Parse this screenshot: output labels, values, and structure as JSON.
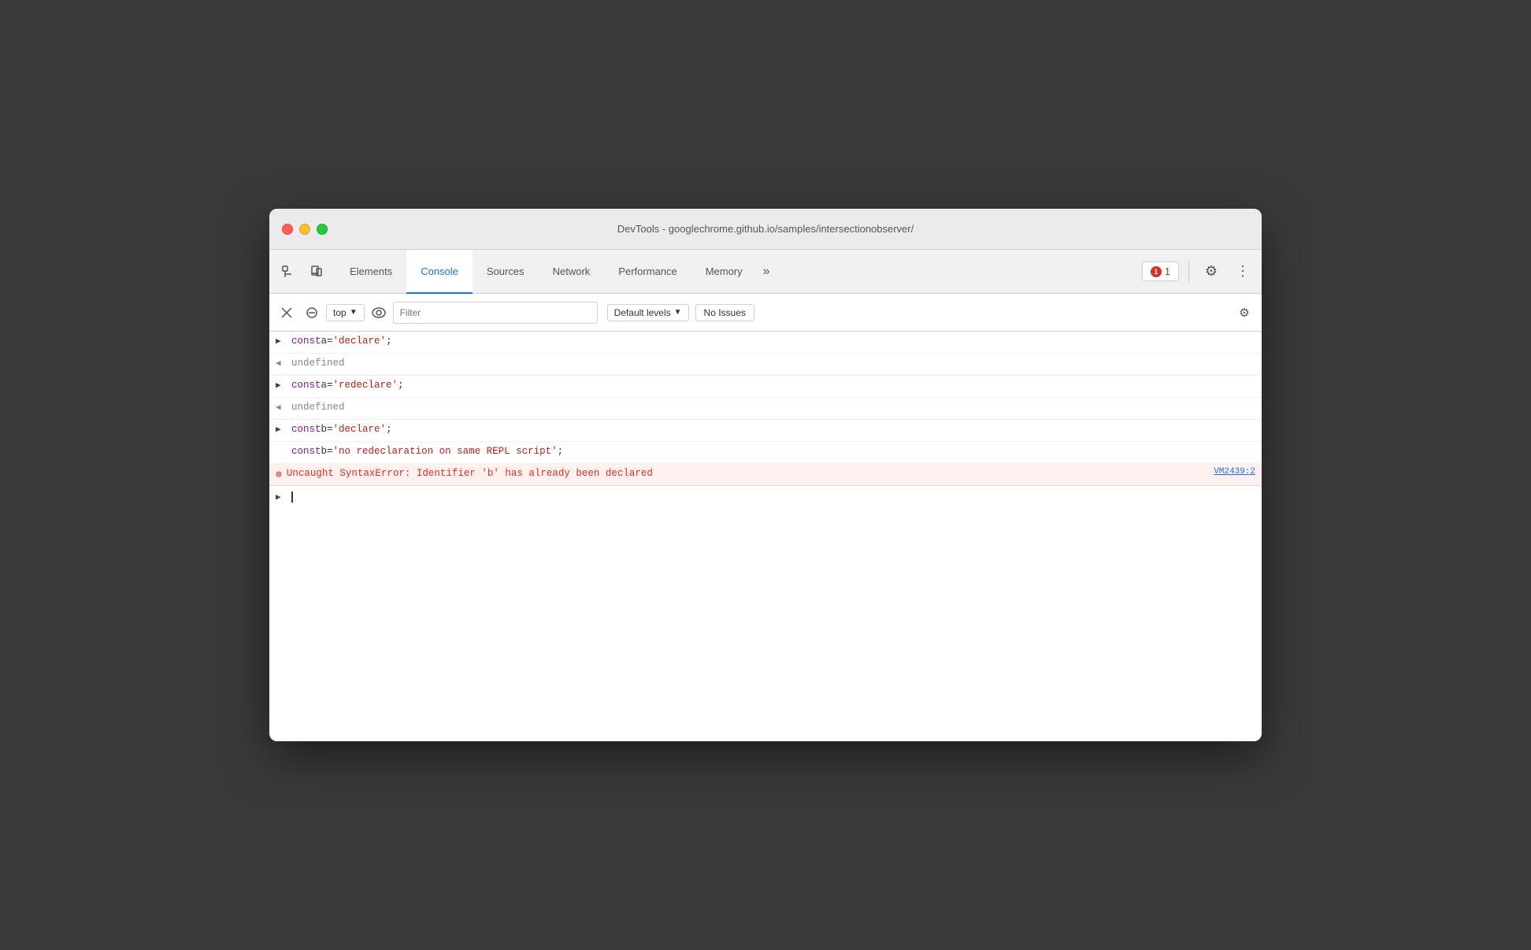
{
  "window": {
    "title": "DevTools - googlechrome.github.io/samples/intersectionobserver/"
  },
  "tabs": {
    "items": [
      {
        "id": "elements",
        "label": "Elements",
        "active": false
      },
      {
        "id": "console",
        "label": "Console",
        "active": true
      },
      {
        "id": "sources",
        "label": "Sources",
        "active": false
      },
      {
        "id": "network",
        "label": "Network",
        "active": false
      },
      {
        "id": "performance",
        "label": "Performance",
        "active": false
      },
      {
        "id": "memory",
        "label": "Memory",
        "active": false
      }
    ],
    "more_label": "»",
    "error_count": "1",
    "settings_label": "⚙",
    "more_options_label": "⋮"
  },
  "console_toolbar": {
    "top_label": "top",
    "filter_placeholder": "Filter",
    "levels_label": "Default levels",
    "no_issues_label": "No Issues"
  },
  "console_output": {
    "lines": [
      {
        "type": "input",
        "arrow": ">",
        "parts": [
          {
            "type": "keyword",
            "text": "const "
          },
          {
            "type": "var",
            "text": "a"
          },
          {
            "type": "punct",
            "text": " = "
          },
          {
            "type": "string",
            "text": "'declare'"
          },
          {
            "type": "punct",
            "text": ";"
          }
        ]
      },
      {
        "type": "output",
        "arrow": "<",
        "text": "undefined"
      },
      {
        "type": "input",
        "arrow": ">",
        "parts": [
          {
            "type": "keyword",
            "text": "const "
          },
          {
            "type": "var",
            "text": "a"
          },
          {
            "type": "punct",
            "text": " = "
          },
          {
            "type": "string",
            "text": "'redeclare'"
          },
          {
            "type": "punct",
            "text": ";"
          }
        ]
      },
      {
        "type": "output",
        "arrow": "<",
        "text": "undefined"
      },
      {
        "type": "input",
        "arrow": ">",
        "parts": [
          {
            "type": "keyword",
            "text": "const "
          },
          {
            "type": "var",
            "text": "b"
          },
          {
            "type": "punct",
            "text": " = "
          },
          {
            "type": "string",
            "text": "'declare'"
          },
          {
            "type": "punct",
            "text": ";"
          }
        ]
      },
      {
        "type": "input-cont",
        "parts": [
          {
            "type": "keyword",
            "text": "const "
          },
          {
            "type": "var",
            "text": "b"
          },
          {
            "type": "punct",
            "text": " = "
          },
          {
            "type": "string",
            "text": "'no redeclaration on same REPL script'"
          },
          {
            "type": "punct",
            "text": ";"
          }
        ]
      },
      {
        "type": "error",
        "text": "Uncaught SyntaxError: Identifier 'b' has already been declared",
        "source": "VM2439:2"
      }
    ]
  }
}
